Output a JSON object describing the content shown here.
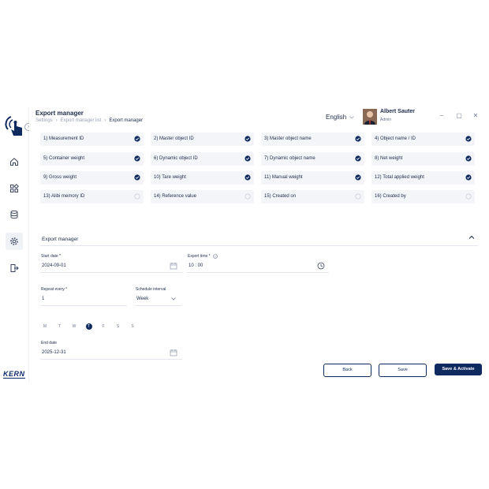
{
  "header": {
    "title": "Export manager",
    "breadcrumb": [
      "Settings",
      "Export manager list",
      "Export manager"
    ],
    "language": "English",
    "user_name": "Albert Sauter",
    "user_role": "Admin"
  },
  "fields": [
    {
      "label": "1) Measurement ID",
      "checked": true
    },
    {
      "label": "2) Master object ID",
      "checked": true
    },
    {
      "label": "3) Master object name",
      "checked": true
    },
    {
      "label": "4) Object name / ID",
      "checked": true
    },
    {
      "label": "5) Container weight",
      "checked": true
    },
    {
      "label": "6) Dynamic object ID",
      "checked": true
    },
    {
      "label": "7) Dynamic object name",
      "checked": true
    },
    {
      "label": "8) Net weight",
      "checked": true
    },
    {
      "label": "9) Gross weight",
      "checked": true
    },
    {
      "label": "10) Tare weight",
      "checked": true
    },
    {
      "label": "11) Manual weight",
      "checked": true
    },
    {
      "label": "12) Total applied weight",
      "checked": true
    },
    {
      "label": "13) Alibi memory ID",
      "checked": false
    },
    {
      "label": "14) Reference value",
      "checked": false
    },
    {
      "label": "15) Created on",
      "checked": false
    },
    {
      "label": "16) Created by",
      "checked": false
    }
  ],
  "export": {
    "section_title": "Export manager",
    "start_date_label": "Start date *",
    "start_date": "2024-09-01",
    "export_time_label": "Export time *",
    "export_time": "10 : 00",
    "repeat_label": "Repeat every *",
    "repeat_value": "1",
    "interval_label": "Schedule interval",
    "interval_value": "Week",
    "days": [
      "M",
      "T",
      "W",
      "T",
      "F",
      "S",
      "S"
    ],
    "selected_day_index": 3,
    "end_date_label": "End date",
    "end_date": "2025-12-31"
  },
  "buttons": {
    "back": "Back",
    "save": "Save",
    "save_activate": "Save & Activate"
  },
  "brand": "KERN",
  "colors": {
    "accent": "#0e2a5e",
    "card": "#f4f5f8"
  }
}
